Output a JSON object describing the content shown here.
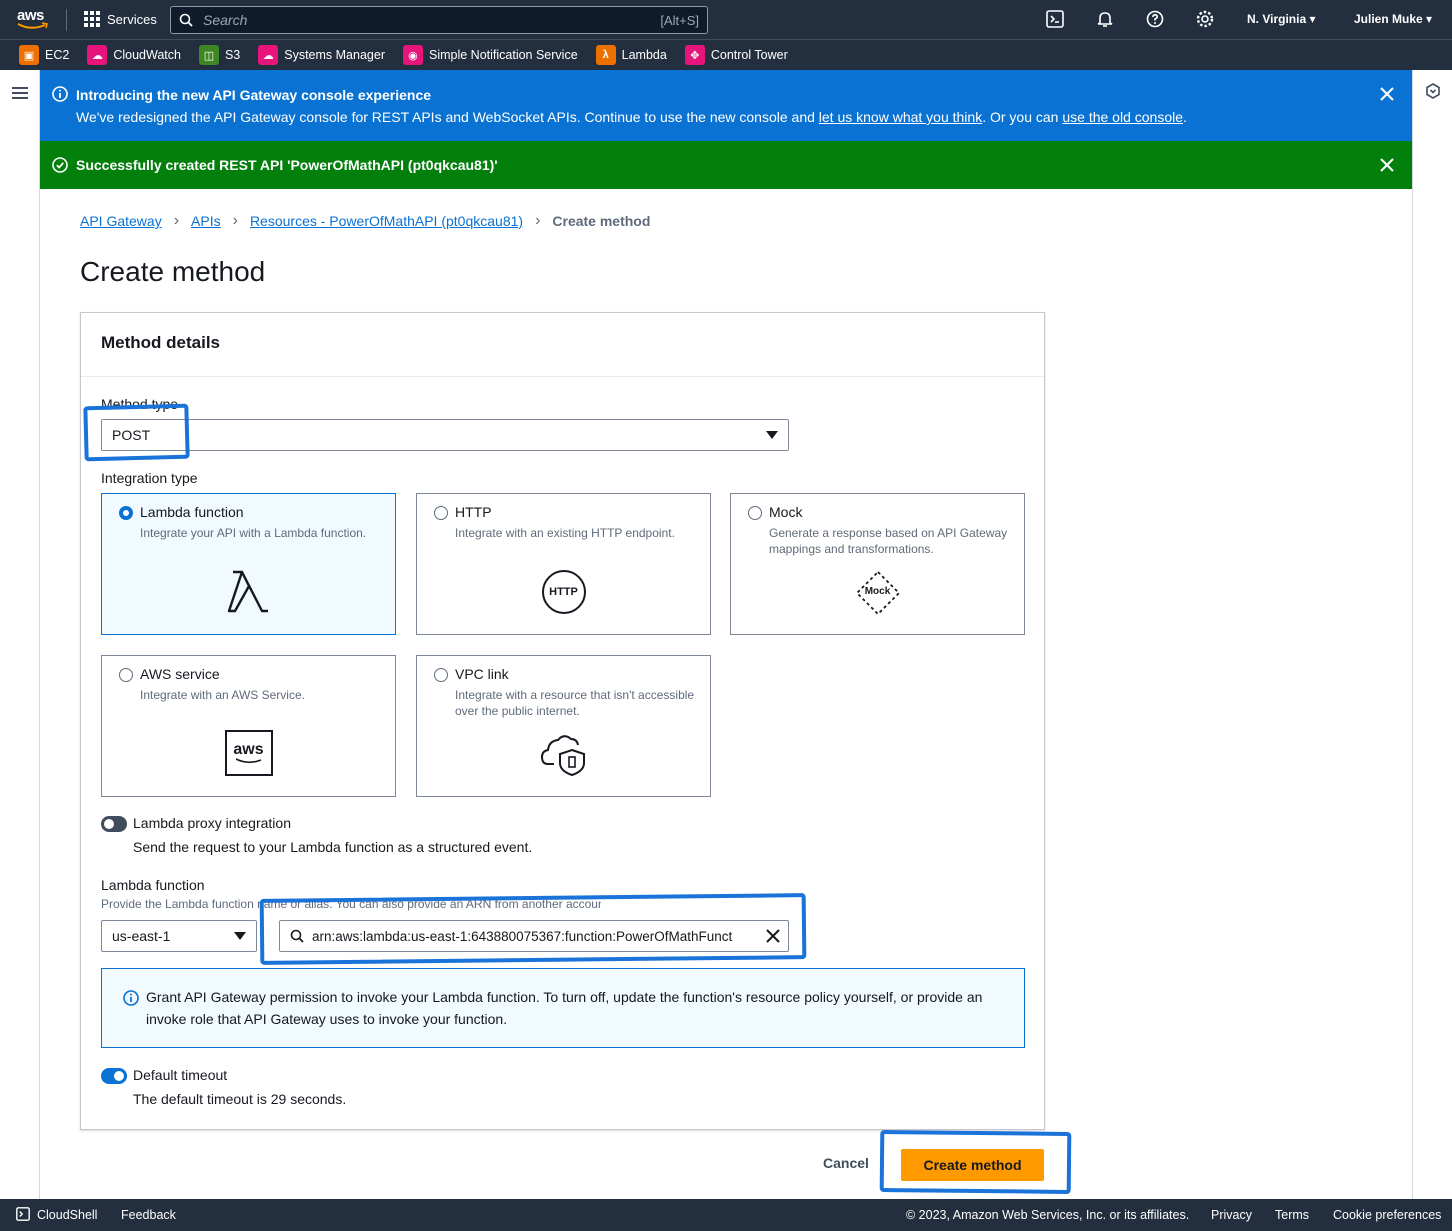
{
  "topnav": {
    "logo_text": "aws",
    "services_label": "Services",
    "search_placeholder": "Search",
    "search_shortcut": "[Alt+S]",
    "region": "N. Virginia",
    "user": "Julien Muke"
  },
  "favorites": [
    {
      "label": "EC2",
      "color": "#ed7100"
    },
    {
      "label": "CloudWatch",
      "color": "#e7157b"
    },
    {
      "label": "S3",
      "color": "#3f8624"
    },
    {
      "label": "Systems Manager",
      "color": "#e7157b"
    },
    {
      "label": "Simple Notification Service",
      "color": "#e7157b"
    },
    {
      "label": "Lambda",
      "color": "#ed7100"
    },
    {
      "label": "Control Tower",
      "color": "#e7157b"
    }
  ],
  "flash_info": {
    "title": "Introducing the new API Gateway console experience",
    "body_prefix": "We've redesigned the API Gateway console for REST APIs and WebSocket APIs. Continue to use the new console and ",
    "link1": "let us know what you think",
    "body_mid": ". Or you can ",
    "link2": "use the old console",
    "body_suffix": "."
  },
  "flash_success": {
    "text": "Successfully created REST API 'PowerOfMathAPI (pt0qkcau81)'"
  },
  "breadcrumb": {
    "items": [
      "API Gateway",
      "APIs",
      "Resources - PowerOfMathAPI (pt0qkcau81)"
    ],
    "current": "Create method"
  },
  "page_title": "Create method",
  "panel": {
    "header": "Method details",
    "method_type_label": "Method type",
    "method_type_value": "POST",
    "integration_type_label": "Integration type",
    "tiles": [
      {
        "title": "Lambda function",
        "desc": "Integrate your API with a Lambda function.",
        "selected": true
      },
      {
        "title": "HTTP",
        "desc": "Integrate with an existing HTTP endpoint.",
        "selected": false,
        "art": "HTTP"
      },
      {
        "title": "Mock",
        "desc": "Generate a response based on API Gateway mappings and transformations.",
        "selected": false,
        "art": "Mock"
      },
      {
        "title": "AWS service",
        "desc": "Integrate with an AWS Service.",
        "selected": false,
        "art": "aws"
      },
      {
        "title": "VPC link",
        "desc": "Integrate with a resource that isn't accessible over the public internet.",
        "selected": false
      }
    ],
    "proxy_label": "Lambda proxy integration",
    "proxy_desc": "Send the request to your Lambda function as a structured event.",
    "lambda_label": "Lambda function",
    "lambda_desc": "Provide the Lambda function name or alias. You can also provide an ARN from another account.",
    "lambda_region": "us-east-1",
    "lambda_arn": "arn:aws:lambda:us-east-1:643880075367:function:PowerOfMathFunct",
    "alert_text": "Grant API Gateway permission to invoke your Lambda function. To turn off, update the function's resource policy yourself, or provide an invoke role that API Gateway uses to invoke your function.",
    "timeout_label": "Default timeout",
    "timeout_desc": "The default timeout is 29 seconds."
  },
  "actions": {
    "cancel": "Cancel",
    "create": "Create method"
  },
  "footer": {
    "cloudshell": "CloudShell",
    "feedback": "Feedback",
    "copyright": "© 2023, Amazon Web Services, Inc. or its affiliates.",
    "privacy": "Privacy",
    "terms": "Terms",
    "cookies": "Cookie preferences"
  }
}
